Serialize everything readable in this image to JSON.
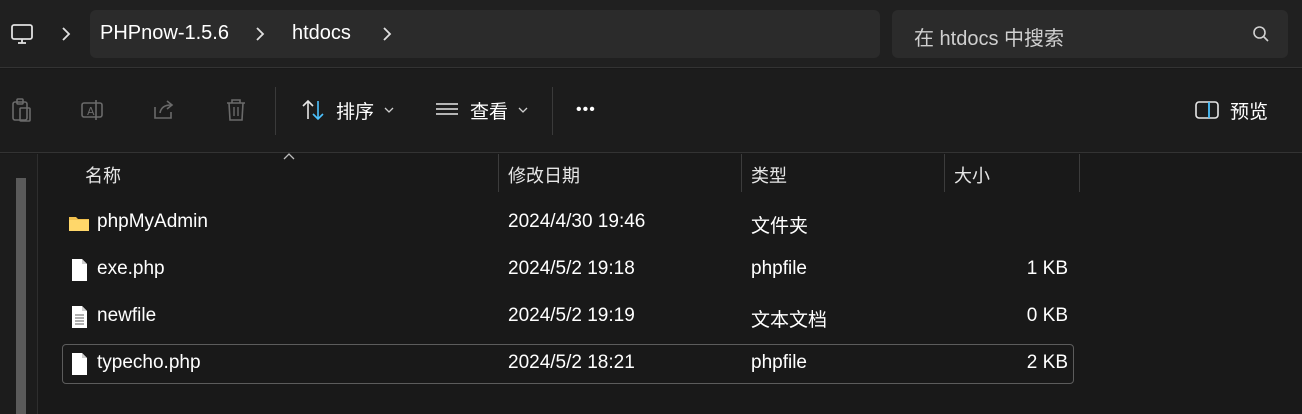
{
  "breadcrumb": {
    "items": [
      "PHPnow-1.5.6",
      "htdocs"
    ]
  },
  "search": {
    "placeholder": "在 htdocs 中搜索"
  },
  "toolbar": {
    "sort_label": "排序",
    "view_label": "查看",
    "more_label": "•••",
    "preview_label": "预览"
  },
  "columns": {
    "name": "名称",
    "modified": "修改日期",
    "type": "类型",
    "size": "大小"
  },
  "files": [
    {
      "name": "phpMyAdmin",
      "modified": "2024/4/30 19:46",
      "type": "文件夹",
      "size": "",
      "icon": "folder-icon"
    },
    {
      "name": "exe.php",
      "modified": "2024/5/2 19:18",
      "type": "phpfile",
      "size": "1 KB",
      "icon": "file-icon"
    },
    {
      "name": "newfile",
      "modified": "2024/5/2 19:19",
      "type": "文本文档",
      "size": "0 KB",
      "icon": "text-file-icon"
    },
    {
      "name": "typecho.php",
      "modified": "2024/5/2 18:21",
      "type": "phpfile",
      "size": "2 KB",
      "icon": "file-icon"
    }
  ],
  "colors": {
    "background": "#191919",
    "folder": "#f2c14e",
    "accent": "#4cc2ff"
  }
}
